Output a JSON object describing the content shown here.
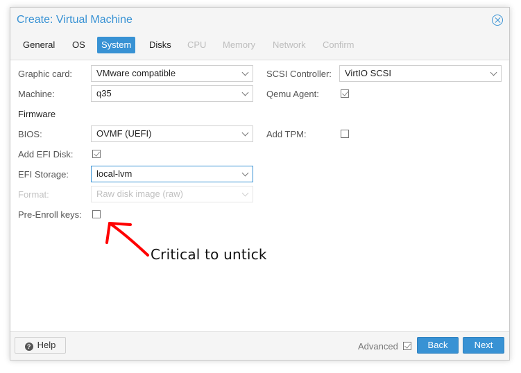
{
  "window": {
    "title": "Create: Virtual Machine"
  },
  "tabs": [
    {
      "label": "General",
      "state": "normal"
    },
    {
      "label": "OS",
      "state": "normal"
    },
    {
      "label": "System",
      "state": "active"
    },
    {
      "label": "Disks",
      "state": "normal"
    },
    {
      "label": "CPU",
      "state": "disabled"
    },
    {
      "label": "Memory",
      "state": "disabled"
    },
    {
      "label": "Network",
      "state": "disabled"
    },
    {
      "label": "Confirm",
      "state": "disabled"
    }
  ],
  "form": {
    "graphic_card": {
      "label": "Graphic card:",
      "value": "VMware compatible"
    },
    "machine": {
      "label": "Machine:",
      "value": "q35"
    },
    "firmware_heading": "Firmware",
    "bios": {
      "label": "BIOS:",
      "value": "OVMF (UEFI)"
    },
    "add_efi_disk": {
      "label": "Add EFI Disk:",
      "checked": true
    },
    "efi_storage": {
      "label": "EFI Storage:",
      "value": "local-lvm"
    },
    "format": {
      "label": "Format:",
      "value": "Raw disk image (raw)",
      "disabled": true
    },
    "pre_enroll": {
      "label": "Pre-Enroll keys:",
      "checked": false
    },
    "scsi_controller": {
      "label": "SCSI Controller:",
      "value": "VirtIO SCSI"
    },
    "qemu_agent": {
      "label": "Qemu Agent:",
      "checked": true
    },
    "add_tpm": {
      "label": "Add TPM:",
      "checked": false
    }
  },
  "annotation": {
    "text": "Critical to untick",
    "color": "#ff0000"
  },
  "footer": {
    "help_label": "Help",
    "advanced_label": "Advanced",
    "advanced_checked": true,
    "back_label": "Back",
    "next_label": "Next"
  },
  "colors": {
    "accent": "#3892d4",
    "annotation": "#ff0000"
  }
}
